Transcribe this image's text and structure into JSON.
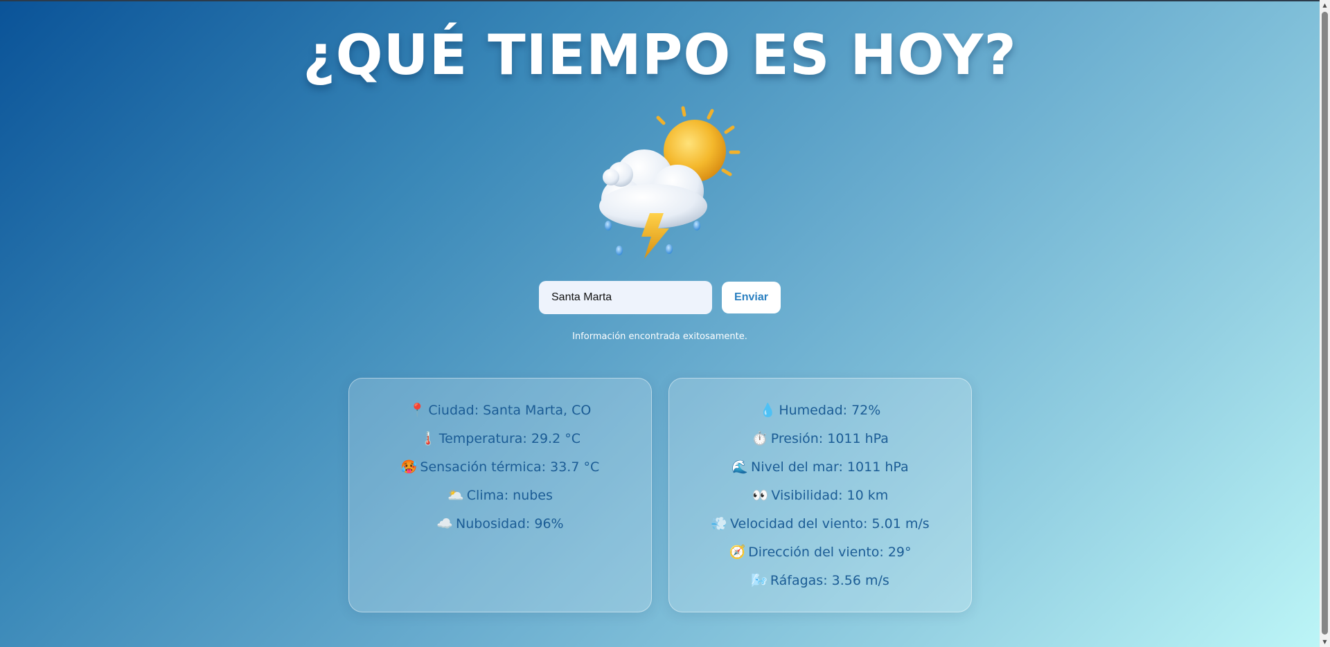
{
  "header": {
    "title": "¿QUÉ TIEMPO ES HOY?"
  },
  "weather_icon": {
    "name": "storm-sun-cloud-icon"
  },
  "search": {
    "value": "Santa Marta",
    "button_label": "Enviar",
    "status_message": "Información encontrada exitosamente."
  },
  "details_left": {
    "items": [
      {
        "icon": "📍",
        "label": "Ciudad: Santa Marta, CO"
      },
      {
        "icon": "🌡️",
        "label": "Temperatura: 29.2 °C"
      },
      {
        "icon": "🥵",
        "label": "Sensación térmica: 33.7 °C"
      },
      {
        "icon": "🌥️",
        "label": "Clima: nubes"
      },
      {
        "icon": "☁️",
        "label": "Nubosidad: 96%"
      }
    ]
  },
  "details_right": {
    "items": [
      {
        "icon": "💧",
        "label": "Humedad: 72%"
      },
      {
        "icon": "⏱️",
        "label": "Presión: 1011 hPa"
      },
      {
        "icon": "🌊",
        "label": "Nivel del mar: 1011 hPa"
      },
      {
        "icon": "👀",
        "label": "Visibilidad: 10 km"
      },
      {
        "icon": "💨",
        "label": "Velocidad del viento: 5.01 m/s"
      },
      {
        "icon": "🧭",
        "label": "Dirección del viento: 29°"
      },
      {
        "icon": "🌬️",
        "label": "Ráfagas: 3.56 m/s"
      }
    ]
  },
  "colors": {
    "gradient_start": "#0a5398",
    "gradient_end": "#bdf6f7",
    "card_text": "#1b5c95",
    "button_text": "#2a7fc0"
  }
}
